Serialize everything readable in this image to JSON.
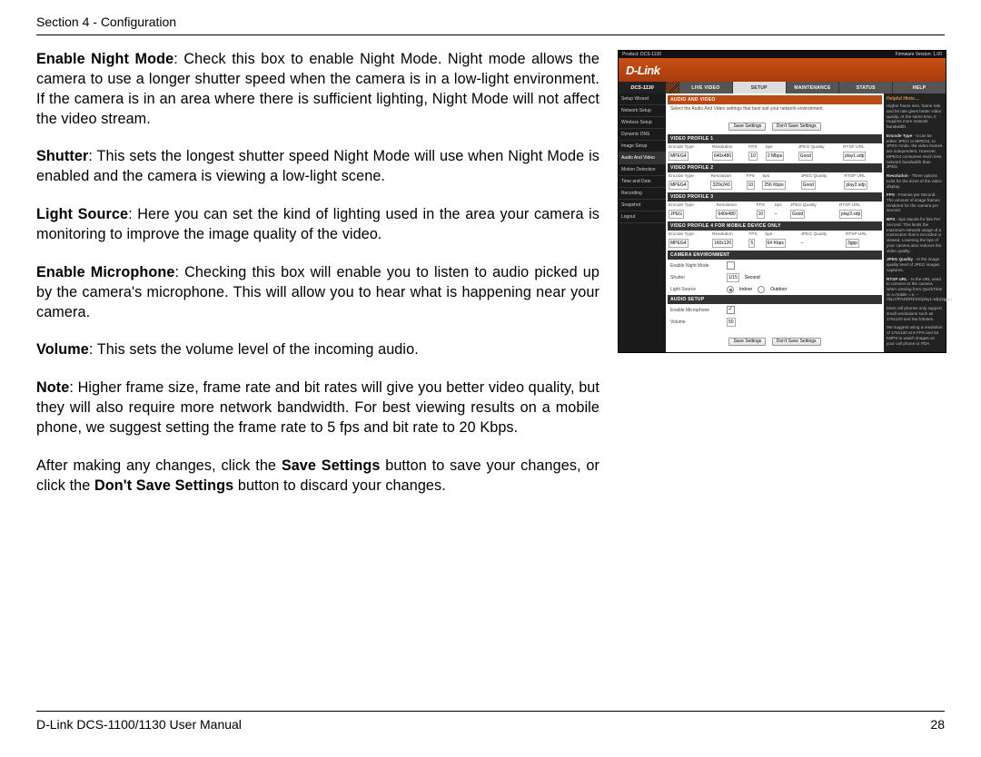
{
  "header": {
    "section": "Section 4 - Configuration"
  },
  "body": {
    "p1_label": "Enable Night Mode",
    "p1_text": ": Check this box to enable Night Mode. Night mode allows the camera to use a longer shutter speed when the camera is in a low-light environment. If the camera is in an area where there is sufficient lighting, Night Mode will not affect the video stream.",
    "p2_label": "Shutter",
    "p2_text": ": This sets the longest shutter speed Night Mode will use when Night Mode is enabled and the camera is viewing a low-light scene.",
    "p3_label": "Light Source",
    "p3_text": ": Here you can set the kind of lighting used in the area your camera is monitoring to improve the image quality of the video.",
    "p4_label": "Enable Microphone",
    "p4_text": ": Checking this box will enable you to listen to audio picked up by the camera's microphone. This will allow you to hear what is happening near your camera.",
    "p5_label": "Volume",
    "p5_text": ": This sets the volume level of the incoming audio.",
    "p6_label": "Note",
    "p6_text": ":  Higher frame size, frame rate and bit rates will give you better video quality, but they will also require more network bandwidth. For best viewing results on a mobile phone, we suggest setting the frame rate to 5 fps and bit rate to 20 Kbps.",
    "p7a": "After making any changes, click the ",
    "p7b": "Save Settings",
    "p7c": " button to save your changes, or click the ",
    "p7d": "Don't Save Settings",
    "p7e": " button to discard your changes."
  },
  "ui": {
    "topbar": {
      "product": "Product: DCS-1130",
      "fw": "Firmware Version: 1.00"
    },
    "logo": "D-Link",
    "model": "DCS-1130",
    "nav": {
      "live": "LIVE VIDEO",
      "setup": "SETUP",
      "maint": "MAINTENANCE",
      "status": "STATUS",
      "help": "HELP"
    },
    "side": {
      "wizard": "Setup Wizard",
      "network": "Network Setup",
      "wireless": "Wireless Setup",
      "ddns": "Dynamic DNS",
      "image": "Image Setup",
      "av": "Audio And Video",
      "motion": "Motion Detection",
      "time": "Time and Date",
      "recording": "Recording",
      "snapshot": "Snapshot",
      "logout": "Logout"
    },
    "sections": {
      "av_title": "AUDIO AND VIDEO",
      "av_msg": "Select the Audio And Video settings that best suit your network environment.",
      "save": "Save Settings",
      "dont": "Don't Save Settings",
      "vp1": "VIDEO PROFILE 1",
      "vp2": "VIDEO PROFILE 2",
      "vp3": "VIDEO PROFILE 3",
      "vp4": "VIDEO PROFILE 4 FOR MOBILE DEVICE ONLY",
      "camenv": "CAMERA ENVIRONMENT",
      "audio": "AUDIO SETUP"
    },
    "cols": {
      "enc": "Encode Type",
      "res": "Resolution",
      "fps": "FPS",
      "bps": "bps",
      "jpeg": "JPEG Quality",
      "rtsp": "RTSP URL"
    },
    "p1": {
      "enc": "MPEG4",
      "res": "640x480",
      "fps": "10",
      "bps": "2 Mbps",
      "jpeg": "Good",
      "rtsp": "play1.sdp"
    },
    "p2": {
      "enc": "MPEG4",
      "res": "320x240",
      "fps": "10",
      "bps": "256 Kbps",
      "jpeg": "Good",
      "rtsp": "play2.sdp"
    },
    "p3": {
      "enc": "JPEG",
      "res": "640x480",
      "fps": "10",
      "bps": "–",
      "jpeg": "Good",
      "rtsp": "play3.sdp"
    },
    "p4": {
      "enc": "MPEG4",
      "res": "160x120",
      "fps": "5",
      "bps": "64 Kbps",
      "jpeg": "–",
      "rtsp": "3gpp"
    },
    "env": {
      "night_label": "Enable Night Mode",
      "shutter_label": "Shutter",
      "shutter_val": "1/15",
      "shutter_unit": "Second",
      "light_label": "Light Source",
      "indoor": "Indoor",
      "outdoor": "Outdoor"
    },
    "audio": {
      "mic_label": "Enable Microphone",
      "vol_label": "Volume",
      "vol_val": "50"
    },
    "hints": {
      "title": "Helpful Hints…",
      "h1": "Higher frame size, frame rate and bit rate gives better video quality. At the same time, it requires more network bandwidth.",
      "h2b": "Encode Type",
      "h2": " - It can be either JPEG or MPEG4. In JPEG mode, the video frames are independent. However, MPEG4 consumes much less network bandwidth than JPEG.",
      "h3b": "Resolution",
      "h3": " - Three options exist for the sizes of the video display.",
      "h4b": "FPS",
      "h4": " - Frames per Second. The amount of image frames rendered for the camera per second.",
      "h5b": "BPS",
      "h5": " - bps stands for bits Per Second. This limits the maximum network usage of a connection that is recorded or viewed. Lowering the bps of your camera also reduces the video quality.",
      "h6b": "JPEG Quality",
      "h6": " - Is the image quality level of JPEG images captures.",
      "h7b": "RTSP URL",
      "h7": " - Is the URL used to connect to the camera when viewing from QuickTime or a mobile. i.e. – rtsp://IPADDRESS/play1.sdp(3gpp)",
      "h8": "Most cell phones only support small resolutions such as 176x120 and low bitrates.",
      "h9": "We suggest using a resolution of 176x120 at 5 FPS and 64 KBPS to watch images on your cell phone or PDA."
    }
  },
  "footer": {
    "left": "D-Link DCS-1100/1130 User Manual",
    "right": "28"
  }
}
